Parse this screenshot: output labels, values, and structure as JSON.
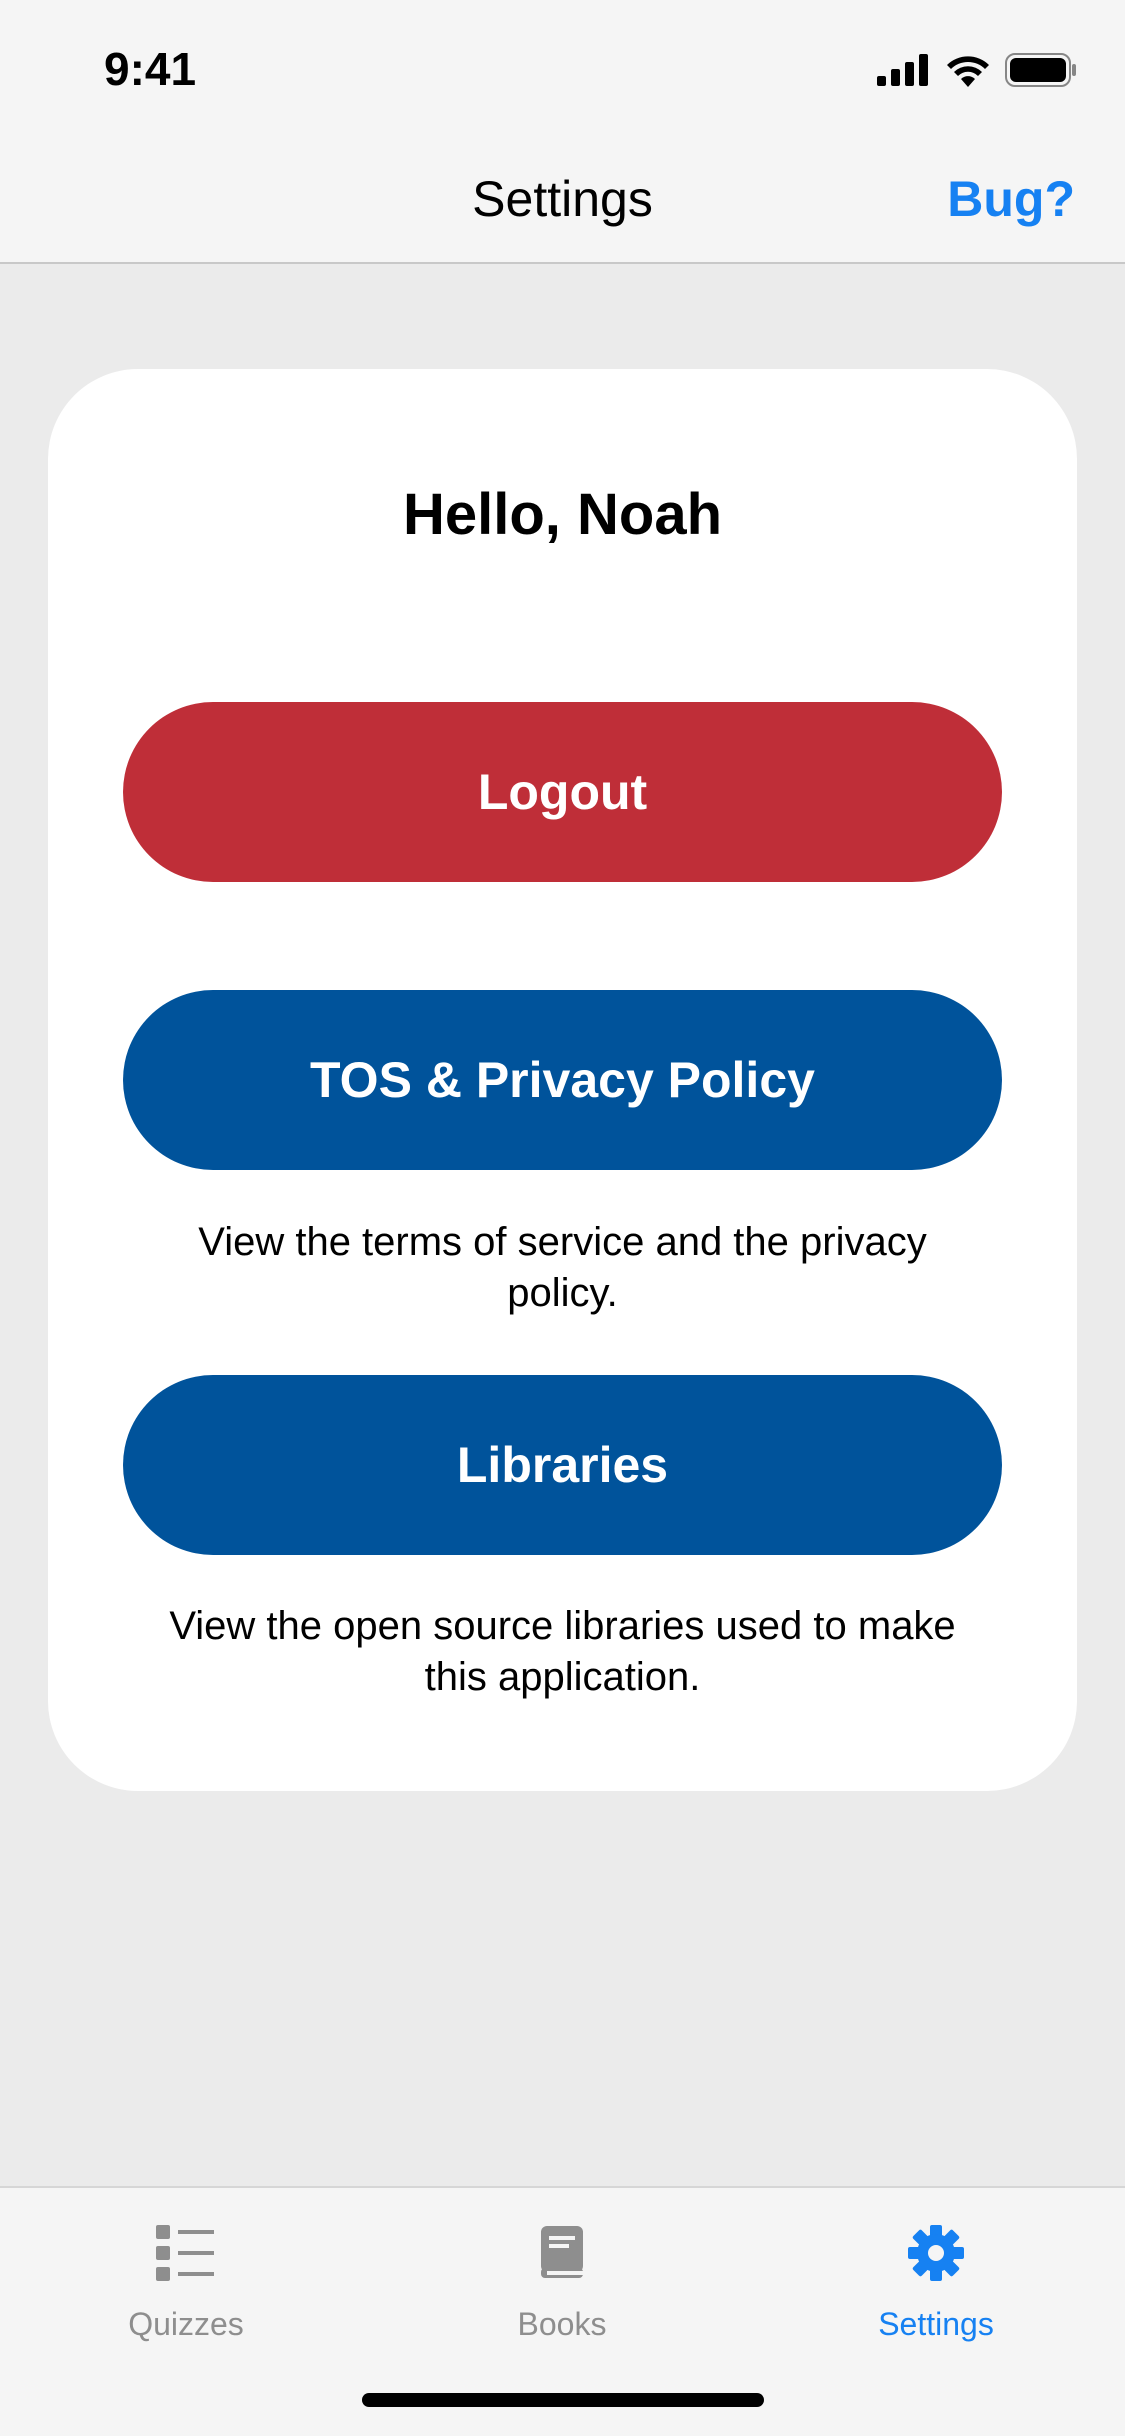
{
  "status_bar": {
    "time": "9:41"
  },
  "nav": {
    "title": "Settings",
    "right_action": "Bug?"
  },
  "card": {
    "greeting": "Hello, Noah",
    "logout_label": "Logout",
    "tos_label": "TOS & Privacy Policy",
    "tos_description": "View the terms of service and the privacy policy.",
    "libraries_label": "Libraries",
    "libraries_description": "View the open source libraries used to make this application."
  },
  "tabs": [
    {
      "label": "Quizzes",
      "icon": "checklist-icon",
      "active": false
    },
    {
      "label": "Books",
      "icon": "book-icon",
      "active": false
    },
    {
      "label": "Settings",
      "icon": "gear-icon",
      "active": true
    }
  ],
  "colors": {
    "accent": "#1681f2",
    "logout": "#bf2e38",
    "primary_button": "#00539b",
    "background": "#ebebeb"
  }
}
